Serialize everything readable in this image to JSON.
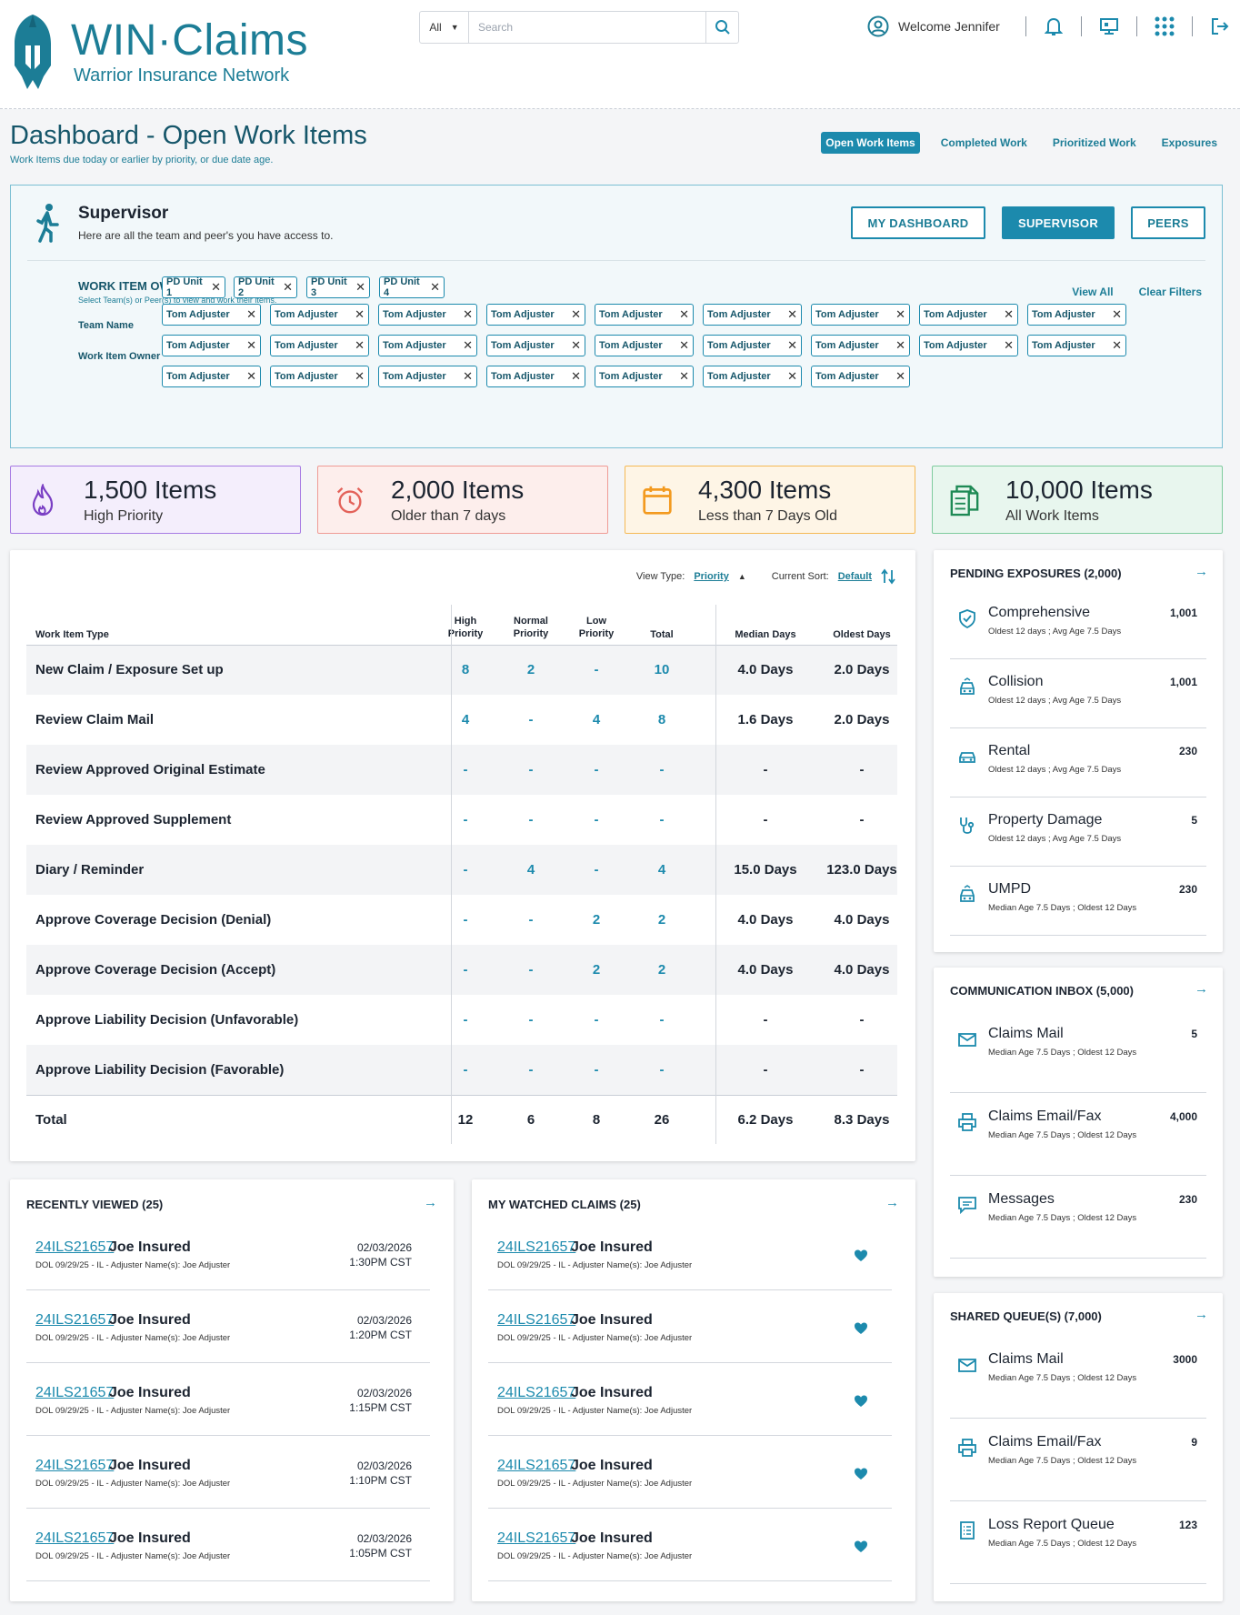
{
  "header": {
    "logo_title": "WIN·Claims",
    "logo_subtitle": "Warrior Insurance Network",
    "search_scope": "All",
    "search_placeholder": "Search",
    "welcome": "Welcome Jennifer"
  },
  "page": {
    "title": "Dashboard - Open Work Items",
    "subtitle": "Work Items due today or earlier by priority, or due date age.",
    "tabs": [
      "Open Work Items",
      "Completed Work",
      "Prioritized Work",
      "Exposures"
    ]
  },
  "supervisor": {
    "title": "Supervisor",
    "subtitle": "Here are all the team and peer's you have access to.",
    "buttons": [
      "MY DASHBOARD",
      "SUPERVISOR",
      "PEERS"
    ],
    "owner_title": "WORK ITEM OWNER",
    "owner_subtitle": "Select Team(s) or Peer(s) to view and work their items.",
    "view_all": "View All",
    "clear_filters": "Clear Filters",
    "team_label": "Team Name",
    "owner_label": "Work Item Owner",
    "teams": [
      "PD Unit 1",
      "PD Unit 2",
      "PD Unit 3",
      "PD Unit 4"
    ],
    "owners": [
      "Tom Adjuster",
      "Tom Adjuster",
      "Tom Adjuster",
      "Tom Adjuster",
      "Tom Adjuster",
      "Tom Adjuster",
      "Tom Adjuster",
      "Tom Adjuster",
      "Tom Adjuster",
      "Tom Adjuster",
      "Tom Adjuster",
      "Tom Adjuster",
      "Tom Adjuster",
      "Tom Adjuster",
      "Tom Adjuster",
      "Tom Adjuster",
      "Tom Adjuster",
      "Tom Adjuster",
      "Tom Adjuster",
      "Tom Adjuster",
      "Tom Adjuster",
      "Tom Adjuster",
      "Tom Adjuster",
      "Tom Adjuster",
      "Tom Adjuster"
    ]
  },
  "stats": [
    {
      "number": "1,500 Items",
      "label": "High Priority",
      "icon": "fire-icon",
      "color": "#7a3fc4"
    },
    {
      "number": "2,000 Items",
      "label": "Older than 7 days",
      "icon": "alarm-clock-icon",
      "color": "#e3625a"
    },
    {
      "number": "4,300 Items",
      "label": "Less than 7 Days Old",
      "icon": "calendar-icon",
      "color": "#f39a1f"
    },
    {
      "number": "10,000 Items",
      "label": "All Work Items",
      "icon": "documents-icon",
      "color": "#1e8a55"
    }
  ],
  "table": {
    "view_type_label": "View Type:",
    "view_type_value": "Priority",
    "sort_label": "Current Sort:",
    "sort_value": "Default",
    "headers": {
      "type": "Work Item Type",
      "high": "High Priority",
      "normal": "Normal Priority",
      "low": "Low Priority",
      "total": "Total",
      "median": "Median Days",
      "oldest": "Oldest Days"
    },
    "rows": [
      {
        "name": "New Claim / Exposure Set up",
        "high": "8",
        "normal": "2",
        "low": "-",
        "total": "10",
        "median": "4.0 Days",
        "oldest": "2.0 Days"
      },
      {
        "name": "Review Claim Mail",
        "high": "4",
        "normal": "-",
        "low": "4",
        "total": "8",
        "median": "1.6 Days",
        "oldest": "2.0 Days"
      },
      {
        "name": "Review Approved Original Estimate",
        "high": "-",
        "normal": "-",
        "low": "-",
        "total": "-",
        "median": "-",
        "oldest": "-"
      },
      {
        "name": "Review Approved Supplement",
        "high": "-",
        "normal": "-",
        "low": "-",
        "total": "-",
        "median": "-",
        "oldest": "-"
      },
      {
        "name": "Diary / Reminder",
        "high": "-",
        "normal": "4",
        "low": "-",
        "total": "4",
        "median": "15.0 Days",
        "oldest": "123.0 Days"
      },
      {
        "name": "Approve Coverage Decision (Denial)",
        "high": "-",
        "normal": "-",
        "low": "2",
        "total": "2",
        "median": "4.0 Days",
        "oldest": "4.0 Days"
      },
      {
        "name": "Approve Coverage Decision (Accept)",
        "high": "-",
        "normal": "-",
        "low": "2",
        "total": "2",
        "median": "4.0 Days",
        "oldest": "4.0 Days"
      },
      {
        "name": "Approve Liability Decision (Unfavorable)",
        "high": "-",
        "normal": "-",
        "low": "-",
        "total": "-",
        "median": "-",
        "oldest": "-"
      },
      {
        "name": "Approve Liability Decision (Favorable)",
        "high": "-",
        "normal": "-",
        "low": "-",
        "total": "-",
        "median": "-",
        "oldest": "-"
      }
    ],
    "total_row": {
      "name": "Total",
      "high": "12",
      "normal": "6",
      "low": "8",
      "total": "26",
      "median": "6.2 Days",
      "oldest": "8.3 Days"
    }
  },
  "pending": {
    "title": "PENDING EXPOSURES (2,000)",
    "items": [
      {
        "name": "Comprehensive",
        "meta": "Oldest 12 days ; Avg Age 7.5 Days",
        "count": "1,001",
        "icon": "shield-check-icon"
      },
      {
        "name": "Collision",
        "meta": "Oldest 12 days ; Avg Age 7.5 Days",
        "count": "1,001",
        "icon": "car-crash-icon"
      },
      {
        "name": "Rental",
        "meta": "Oldest 12 days ; Avg Age 7.5 Days",
        "count": "230",
        "icon": "car-icon"
      },
      {
        "name": "Property Damage",
        "meta": "Oldest 12 days ; Avg Age 7.5 Days",
        "count": "5",
        "icon": "stethoscope-icon"
      },
      {
        "name": "UMPD",
        "meta": "Median Age 7.5 Days ; Oldest 12 Days",
        "count": "230",
        "icon": "car-crash-icon"
      }
    ]
  },
  "comm": {
    "title": "COMMUNICATION INBOX (5,000)",
    "items": [
      {
        "name": "Claims Mail",
        "meta": "Median Age 7.5 Days ; Oldest 12 Days",
        "count": "5",
        "icon": "envelope-icon"
      },
      {
        "name": "Claims Email/Fax",
        "meta": "Median Age 7.5 Days ; Oldest 12 Days",
        "count": "4,000",
        "icon": "printer-icon"
      },
      {
        "name": "Messages",
        "meta": "Median Age 7.5 Days ; Oldest 12 Days",
        "count": "230",
        "icon": "message-icon"
      }
    ]
  },
  "shared": {
    "title": "SHARED QUEUE(S) (7,000)",
    "items": [
      {
        "name": "Claims Mail",
        "meta": "Median Age 7.5 Days ; Oldest 12 Days",
        "count": "3000",
        "icon": "envelope-icon"
      },
      {
        "name": "Claims Email/Fax",
        "meta": "Median Age 7.5 Days ; Oldest 12 Days",
        "count": "9",
        "icon": "printer-icon"
      },
      {
        "name": "Loss Report Queue",
        "meta": "Median Age 7.5 Days ; Oldest 12 Days",
        "count": "123",
        "icon": "list-icon"
      }
    ]
  },
  "recent": {
    "title": "RECENTLY VIEWED (25)",
    "items": [
      {
        "id": "24ILS21657",
        "name": "Joe Insured",
        "meta": "DOL 09/29/25  - IL - Adjuster Name(s): Joe Adjuster",
        "date": "02/03/2026",
        "time": "1:30PM CST"
      },
      {
        "id": "24ILS21657",
        "name": "Joe Insured",
        "meta": "DOL 09/29/25  - IL - Adjuster Name(s): Joe Adjuster",
        "date": "02/03/2026",
        "time": "1:20PM CST"
      },
      {
        "id": "24ILS21657",
        "name": "Joe Insured",
        "meta": "DOL 09/29/25  - IL - Adjuster Name(s): Joe Adjuster",
        "date": "02/03/2026",
        "time": "1:15PM CST"
      },
      {
        "id": "24ILS21657",
        "name": "Joe Insured",
        "meta": "DOL 09/29/25  - IL - Adjuster Name(s): Joe Adjuster",
        "date": "02/03/2026",
        "time": "1:10PM CST"
      },
      {
        "id": "24ILS21657",
        "name": "Joe Insured",
        "meta": "DOL 09/29/25  - IL - Adjuster Name(s): Joe Adjuster",
        "date": "02/03/2026",
        "time": "1:05PM CST"
      }
    ]
  },
  "watched": {
    "title": "MY WATCHED CLAIMS (25)",
    "items": [
      {
        "id": "24ILS21657",
        "name": "Joe Insured",
        "meta": "DOL 09/29/25  - IL - Adjuster Name(s): Joe Adjuster"
      },
      {
        "id": "24ILS21657",
        "name": "Joe Insured",
        "meta": "DOL 09/29/25  - IL - Adjuster Name(s): Joe Adjuster"
      },
      {
        "id": "24ILS21657",
        "name": "Joe Insured",
        "meta": "DOL 09/29/25  - IL - Adjuster Name(s): Joe Adjuster"
      },
      {
        "id": "24ILS21657",
        "name": "Joe Insured",
        "meta": "DOL 09/29/25  - IL - Adjuster Name(s): Joe Adjuster"
      },
      {
        "id": "24ILS21657",
        "name": "Joe Insured",
        "meta": "DOL 09/29/25  - IL - Adjuster Name(s): Joe Adjuster"
      }
    ]
  },
  "colors": {
    "accent": "#1c8aad",
    "brand": "#1c7d96"
  }
}
